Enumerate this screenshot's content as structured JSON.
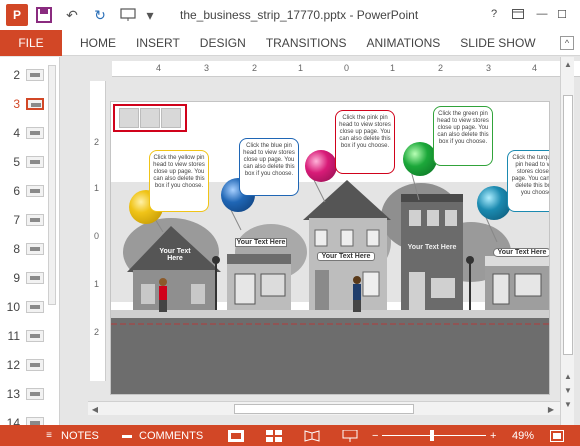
{
  "window": {
    "title": "the_business_strip_17770.pptx - PowerPoint",
    "help": "?",
    "minimize": "—",
    "maximize": "☐",
    "close": "✕"
  },
  "qat": {
    "undo": "↶",
    "redo": "↻",
    "dropdown": "▾"
  },
  "ribbon": {
    "file": "FILE",
    "tabs": [
      "HOME",
      "INSERT",
      "DESIGN",
      "TRANSITIONS",
      "ANIMATIONS",
      "SLIDE SHOW"
    ],
    "collapse": "^"
  },
  "thumbnails": [
    {
      "number": "2"
    },
    {
      "number": "3"
    },
    {
      "number": "4"
    },
    {
      "number": "5"
    },
    {
      "number": "6"
    },
    {
      "number": "7"
    },
    {
      "number": "8"
    },
    {
      "number": "9"
    },
    {
      "number": "10"
    },
    {
      "number": "11"
    },
    {
      "number": "12"
    },
    {
      "number": "13"
    },
    {
      "number": "14"
    }
  ],
  "selected_slide": "3",
  "ruler_h": [
    "4",
    "3",
    "2",
    "1",
    "0",
    "1",
    "2",
    "3",
    "4"
  ],
  "ruler_v": [
    "2",
    "1",
    "0",
    "1",
    "2"
  ],
  "slide": {
    "callouts": [
      {
        "text": "Click the yellow pin head to view stores close up page. You can also delete this box if you choose.",
        "color": "#f0c418"
      },
      {
        "text": "Click the blue pin head to view stores close up page. You can also delete this box if you choose.",
        "color": "#1f66b5"
      },
      {
        "text": "Click the pink pin head to view stores close up page. You can also delete this box if you choose.",
        "color": "#d0021b"
      },
      {
        "text": "Click the green pin head to view stores close up page. You can also delete this box if you choose.",
        "color": "#31a33a"
      },
      {
        "text": "Click the turquoise pin head to view stores close up page. You can also delete this box if you choose.",
        "color": "#1b8ab0"
      }
    ],
    "labels": {
      "house1": "Your Text Here",
      "shop1": "Your Text Here",
      "house2": "Your Text Here",
      "building": "Your Text Here",
      "shop2": "Your Text Here"
    },
    "pin_colors": {
      "yellow": "#f0c418",
      "blue": "#1f66b5",
      "pink": "#d81b78",
      "green": "#1ca83a",
      "turquoise": "#1b8ab0"
    }
  },
  "statusbar": {
    "notes": "NOTES",
    "comments": "COMMENTS",
    "zoom": "49%",
    "minus": "−",
    "plus": "+"
  },
  "colors": {
    "accent": "#d24726"
  }
}
